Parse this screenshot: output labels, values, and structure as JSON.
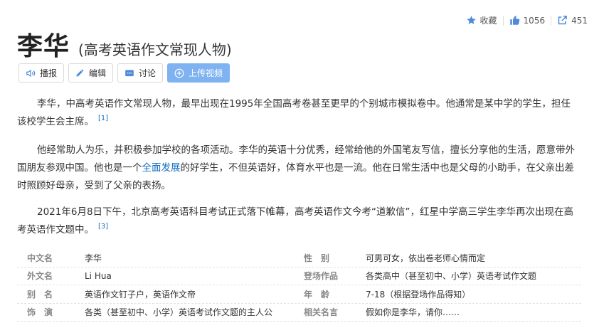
{
  "top_actions": {
    "favorite_label": "收藏",
    "like_count": "1056",
    "share_count": "451"
  },
  "header": {
    "title": "李华",
    "subtitle": "(高考英语作文常现人物)"
  },
  "toolbar": {
    "broadcast_label": "播报",
    "edit_label": "编辑",
    "discuss_label": "讨论",
    "upload_label": "上传视频"
  },
  "paragraphs": [
    {
      "text": "李华，中高考英语作文常现人物，最早出现在1995年全国高考卷甚至更早的个别城市模拟卷中。他通常是某中学的学生，担任该校学生会主席。",
      "ref": "[1]"
    },
    {
      "before": "他经常助人为乐，并积极参加学校的各项活动。李华的英语十分优秀，经常给他的外国笔友写信，擅长分享他的生活，愿意带外国朋友参观中国。他也是一个",
      "link": "全面发展",
      "after": "的好学生，不但英语好，体育水平也是一流。他在日常生活中也是父母的小助手，在父亲出差时照顾好母亲，受到了父亲的表扬。"
    },
    {
      "text": "2021年6月8日下午，北京高考英语科目考试正式落下帷幕，高考英语作文今考“道歉信”，红星中学高三学生李华再次出现在高考英语作文题中。",
      "ref": "[3]"
    }
  ],
  "info_rows": [
    {
      "k1": "中文名",
      "v1": "李华",
      "k2": "性　别",
      "v2": "可男可女，依出卷老师心情而定"
    },
    {
      "k1": "外文名",
      "v1": "Li Hua",
      "k2": "登场作品",
      "v2": "各类高中（甚至初中、小学）英语考试作文题"
    },
    {
      "k1": "别　名",
      "v1": "英语作文钉子户，英语作文帝",
      "k2": "年　龄",
      "v2": "7-18（根据登场作品得知）"
    },
    {
      "k1": "饰　演",
      "v1": "各类（甚至初中、小学）英语考试作文题的主人公",
      "k2": "相关名言",
      "v2": "假如你是李华，请你……"
    }
  ],
  "colors": {
    "accent_blue": "#136ec2",
    "upload_button": "#7fb2f1",
    "icon_blue": "#4f8ad9"
  }
}
